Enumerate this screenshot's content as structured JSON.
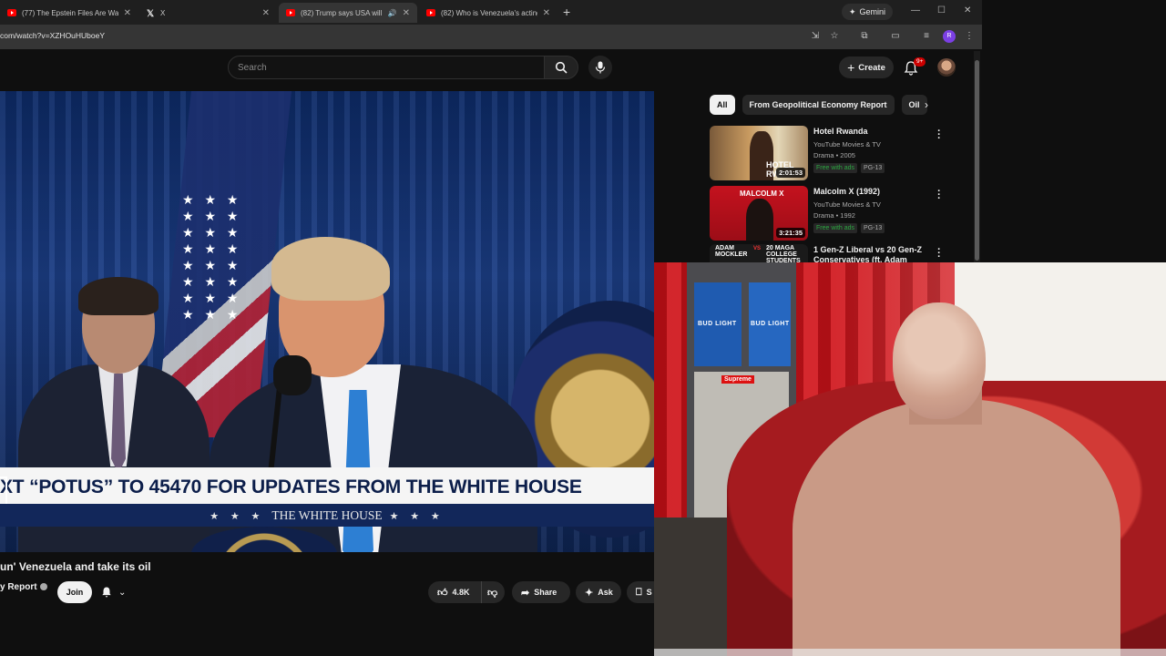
{
  "browser": {
    "tabs": [
      {
        "title": "(77) The Epstein Files Are Way",
        "active": false,
        "favicon": "youtube-icon"
      },
      {
        "title": "X",
        "active": false,
        "favicon": "x-icon"
      },
      {
        "title": "(82) Trump says USA will 'ru",
        "active": true,
        "favicon": "youtube-icon"
      },
      {
        "title": "(82) Who is Venezuela's acting",
        "active": false,
        "favicon": "youtube-icon"
      }
    ],
    "new_tab": "+",
    "gemini_label": "Gemini",
    "url": "com/watch?v=XZHOuHUboeY",
    "profile_initial": "R"
  },
  "youtube": {
    "search_placeholder": "Search",
    "create_label": "Create",
    "notification_badge": "9+"
  },
  "video": {
    "banner_text": "XT “POTUS” TO 45470 FOR UPDATES FROM THE WHITE HOUSE",
    "banner_stars": "★ ★ ★",
    "banner_subtitle": "THE WHITE HOUSE",
    "title": "un' Venezuela and take its oil",
    "channel": "y Report",
    "join_label": "Join",
    "like_count": "4.8K",
    "share_label": "Share",
    "ask_label": "Ask",
    "save_label": "S"
  },
  "sidebar": {
    "chips": [
      {
        "label": "All",
        "active": true
      },
      {
        "label": "From Geopolitical Economy Report",
        "active": false
      },
      {
        "label": "Oil",
        "active": false
      }
    ],
    "recommendations": [
      {
        "title": "Hotel Rwanda",
        "channel": "YouTube Movies & TV",
        "meta": "Drama • 2005",
        "free": "Free with ads",
        "rating": "PG-13",
        "duration": "2:01:53",
        "thumb_text": "HOTEL RW"
      },
      {
        "title": "Malcolm X (1992)",
        "channel": "YouTube Movies & TV",
        "meta": "Drama • 1992",
        "free": "Free with ads",
        "rating": "PG-13",
        "duration": "3:21:35",
        "thumb_text": "MALCOLM X"
      },
      {
        "title": "1 Gen-Z Liberal vs 20 Gen-Z Conservatives (ft. Adam",
        "thumb_left": "ADAM MOCKLER",
        "thumb_mid": "VS",
        "thumb_right": "20 MAGA COLLEGE STUDENTS"
      }
    ]
  },
  "webcam": {
    "box_label_1": "BUD LIGHT",
    "box_label_2": "BUD LIGHT",
    "sticker": "Supreme"
  }
}
